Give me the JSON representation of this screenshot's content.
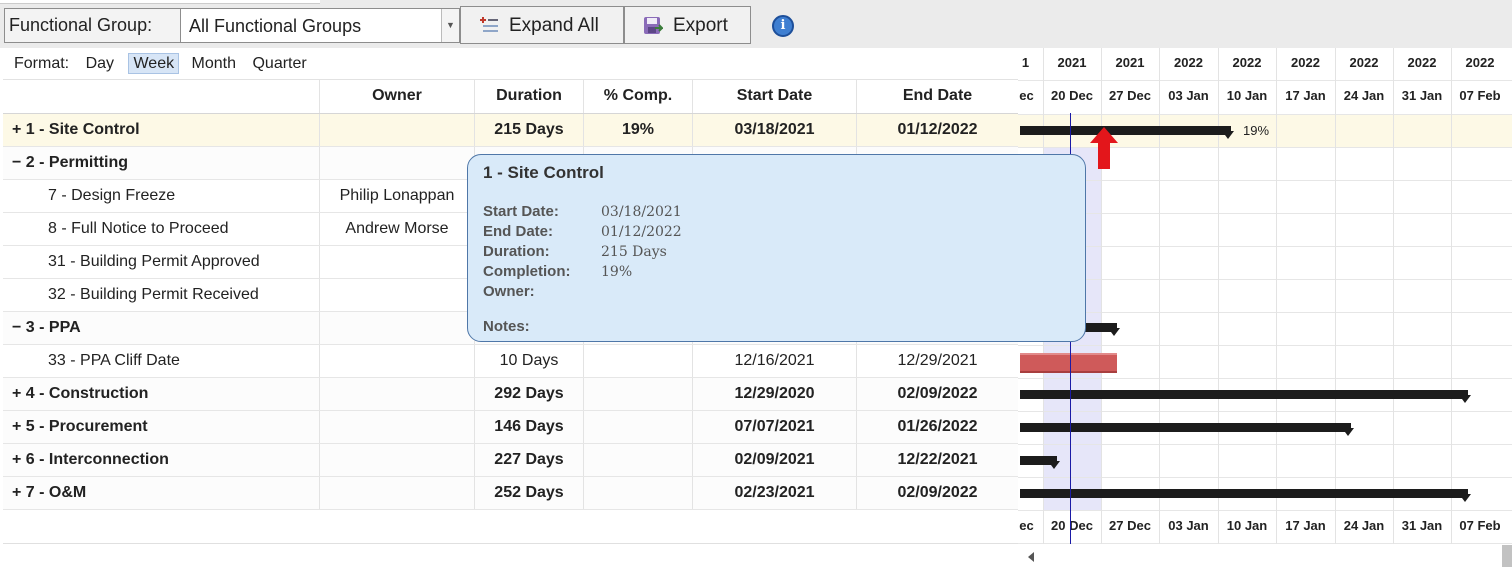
{
  "toolbar": {
    "functional_group_label": "Functional Group:",
    "functional_group_value": "All Functional Groups",
    "expand_all_label": "Expand All",
    "export_label": "Export",
    "info_icon": "info-icon"
  },
  "format": {
    "label": "Format:",
    "options": [
      "Day",
      "Week",
      "Month",
      "Quarter"
    ],
    "selected": "Week"
  },
  "columns": {
    "owner": "Owner",
    "duration": "Duration",
    "pct_comp": "% Comp.",
    "start_date": "Start Date",
    "end_date": "End Date"
  },
  "rows": [
    {
      "name": "+ 1 - Site Control",
      "owner": "",
      "duration": "215 Days",
      "pct": "19%",
      "start": "03/18/2021",
      "end": "01/12/2022"
    },
    {
      "name": "− 2 - Permitting",
      "owner": "",
      "duration": "",
      "pct": "",
      "start": "",
      "end": ""
    },
    {
      "name": "7 - Design Freeze",
      "owner": "Philip Lonappan",
      "duration": "",
      "pct": "",
      "start": "",
      "end": ""
    },
    {
      "name": "8 - Full Notice to Proceed",
      "owner": "Andrew Morse",
      "duration": "",
      "pct": "",
      "start": "",
      "end": ""
    },
    {
      "name": "31 - Building Permit Approved",
      "owner": "",
      "duration": "",
      "pct": "",
      "start": "",
      "end": ""
    },
    {
      "name": "32 - Building Permit Received",
      "owner": "",
      "duration": "",
      "pct": "",
      "start": "",
      "end": ""
    },
    {
      "name": "− 3 - PPA",
      "owner": "",
      "duration": "",
      "pct": "",
      "start": "",
      "end": ""
    },
    {
      "name": "33 - PPA Cliff Date",
      "owner": "",
      "duration": "10 Days",
      "pct": "",
      "start": "12/16/2021",
      "end": "12/29/2021"
    },
    {
      "name": "+ 4 - Construction",
      "owner": "",
      "duration": "292 Days",
      "pct": "",
      "start": "12/29/2020",
      "end": "02/09/2022"
    },
    {
      "name": "+ 5 - Procurement",
      "owner": "",
      "duration": "146 Days",
      "pct": "",
      "start": "07/07/2021",
      "end": "01/26/2022"
    },
    {
      "name": "+ 6 - Interconnection",
      "owner": "",
      "duration": "227 Days",
      "pct": "",
      "start": "02/09/2021",
      "end": "12/22/2021"
    },
    {
      "name": "+ 7 - O&M",
      "owner": "",
      "duration": "252 Days",
      "pct": "",
      "start": "02/23/2021",
      "end": "02/09/2022"
    }
  ],
  "gantt": {
    "years": [
      "1",
      "2021",
      "2021",
      "2022",
      "2022",
      "2022",
      "2022",
      "2022",
      "2022"
    ],
    "weeks": [
      "ec",
      "20 Dec",
      "27 Dec",
      "03 Jan",
      "10 Jan",
      "17 Jan",
      "24 Jan",
      "31 Jan",
      "07 Feb"
    ],
    "site_control_pct_label": "19%"
  },
  "tooltip": {
    "title": "1 - Site Control",
    "start_label": "Start Date:",
    "start_value": "03/18/2021",
    "end_label": "End Date:",
    "end_value": "01/12/2022",
    "duration_label": "Duration:",
    "duration_value": "215 Days",
    "completion_label": "Completion:",
    "completion_value": "19%",
    "owner_label": "Owner:",
    "owner_value": "",
    "notes_label": "Notes:",
    "notes_value": ""
  },
  "colors": {
    "highlight_row": "#fdf9e6",
    "today_line": "#1a1aa6",
    "tooltip_bg": "#d9eaf9",
    "ppa_bar": "#cf5a5a",
    "annotation_arrow": "#e3161b"
  }
}
